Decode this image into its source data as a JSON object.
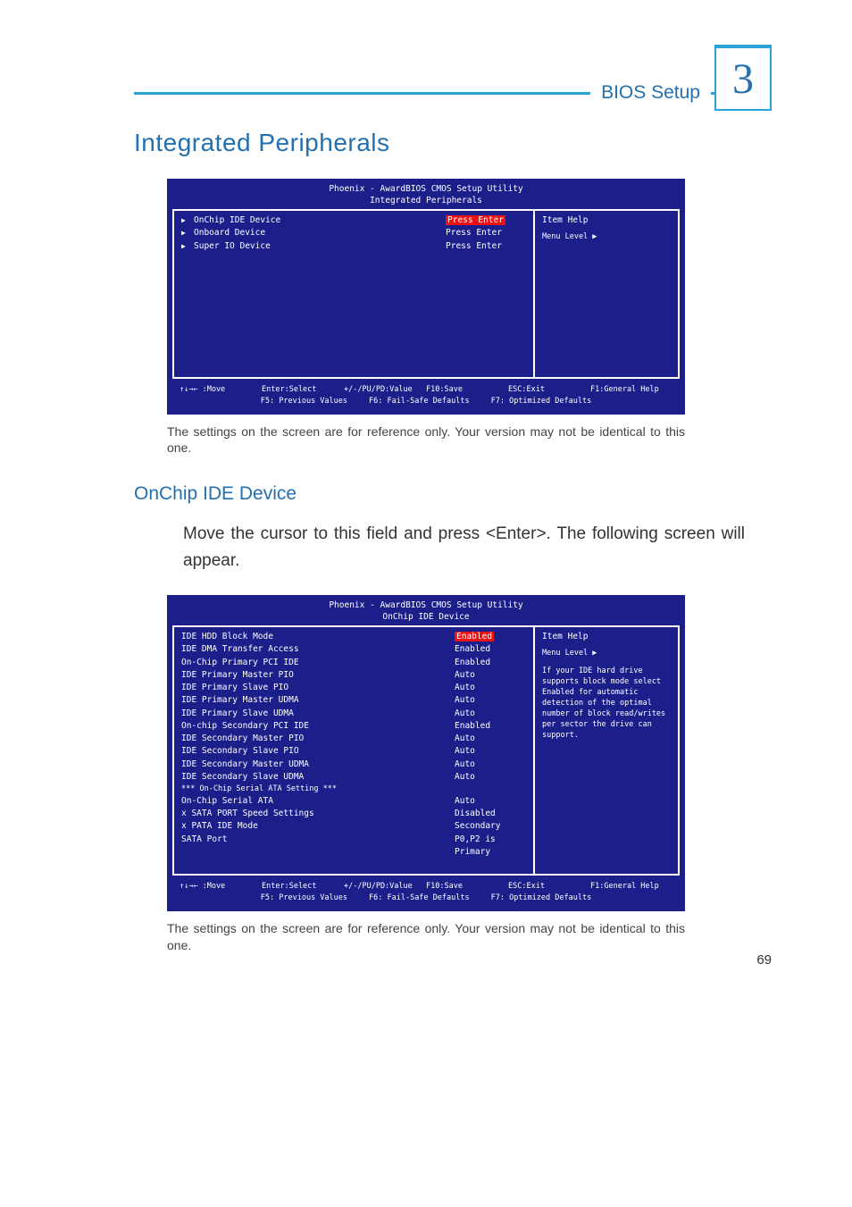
{
  "header": {
    "label": "BIOS Setup",
    "chapter": "3"
  },
  "headings": {
    "main": "Integrated Peripherals",
    "sub1": "OnChip IDE Device"
  },
  "caption": "The settings on the screen are for reference only. Your version may not be identical to this one.",
  "body1": "Move the cursor to this field and press <Enter>. The following screen will appear.",
  "panel1": {
    "title": "Phoenix - AwardBIOS CMOS Setup Utility",
    "subtitle": "Integrated Peripherals",
    "rows": [
      {
        "tri": "▶",
        "label": "OnChip IDE Device",
        "val": "Press Enter",
        "hl": true
      },
      {
        "tri": "▶",
        "label": "Onboard Device",
        "val": "Press Enter",
        "hl": false
      },
      {
        "tri": "▶",
        "label": "Super IO Device",
        "val": "Press Enter",
        "hl": false
      }
    ],
    "help": {
      "title": "Item Help",
      "level": "Menu Level   ▶"
    }
  },
  "panel2": {
    "title": "Phoenix - AwardBIOS CMOS Setup Utility",
    "subtitle": "OnChip IDE Device",
    "rows": [
      {
        "label": "IDE HDD Block Mode",
        "val": "Enabled",
        "hl": true
      },
      {
        "label": "IDE DMA Transfer Access",
        "val": "Enabled"
      },
      {
        "label": "On-Chip Primary PCI IDE",
        "val": "Enabled"
      },
      {
        "label": "IDE Primary Master PIO",
        "val": "Auto"
      },
      {
        "label": "IDE Primary Slave PIO",
        "val": "Auto"
      },
      {
        "label": "IDE Primary Master UDMA",
        "val": "Auto"
      },
      {
        "label": "IDE Primary Slave UDMA",
        "val": "Auto"
      },
      {
        "label": "On-chip Secondary PCI IDE",
        "val": "Enabled"
      },
      {
        "label": "IDE Secondary Master PIO",
        "val": "Auto"
      },
      {
        "label": "IDE Secondary Slave PIO",
        "val": "Auto"
      },
      {
        "label": "IDE Secondary Master UDMA",
        "val": "Auto"
      },
      {
        "label": "IDE Secondary Slave UDMA",
        "val": "Auto"
      },
      {
        "label": "",
        "val": ""
      },
      {
        "label": "*** On-Chip Serial ATA Setting ***",
        "val": ""
      },
      {
        "label": "On-Chip Serial ATA",
        "val": "Auto"
      },
      {
        "label": "x  SATA PORT Speed Settings",
        "val": "Disabled"
      },
      {
        "label": "x  PATA IDE Mode",
        "val": "Secondary"
      },
      {
        "label": "    SATA Port",
        "val": "P0,P2 is Primary"
      }
    ],
    "help": {
      "title": "Item Help",
      "level": "Menu Level   ▶",
      "text": "If your IDE hard drive supports block mode select Enabled for automatic detection of the optimal number of block read/writes per sector the drive can support."
    }
  },
  "footer": {
    "r1c1": "↑↓→← :Move",
    "r1c2": "Enter:Select",
    "r1c3": "+/-/PU/PD:Value",
    "r1c4": "F10:Save",
    "r1c5": "ESC:Exit",
    "r1c6": "F1:General Help",
    "r2c1": "F5: Previous Values",
    "r2c2": "F6: Fail-Safe Defaults",
    "r2c3": "F7: Optimized Defaults"
  },
  "page_num": "69"
}
